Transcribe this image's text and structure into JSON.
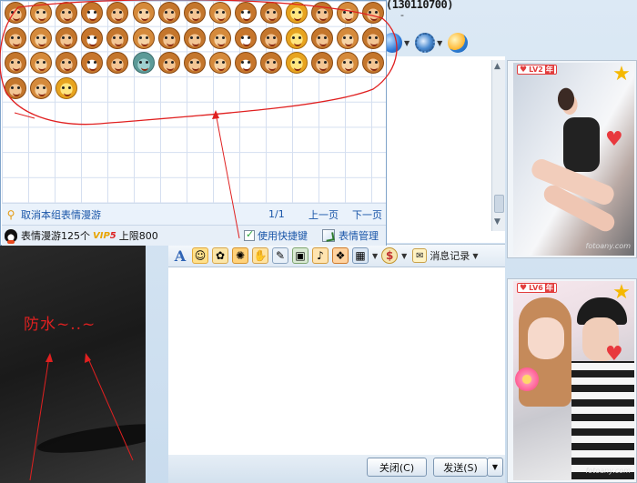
{
  "window": {
    "title_number": "(130110700)",
    "title_suffix": "-"
  },
  "emoticon_panel": {
    "cancel_roam_label": "取消本组表情漫游",
    "page_indicator": "1/1",
    "prev_page": "上一页",
    "next_page": "下一页",
    "roam_count_label": "表情漫游125个",
    "vip_label": "VIP",
    "vip_level": "5",
    "limit_label": "上限800",
    "shortcut_label": "使用快捷键",
    "manage_label": "表情管理",
    "emoticon_count_visible": 48
  },
  "input_toolbar": {
    "font_icon": "A",
    "message_record_label": "消息记录"
  },
  "buttons": {
    "close_label": "关闭(C)",
    "send_label": "发送(S)"
  },
  "show_panels": [
    {
      "level": "LV2",
      "year_badge": "年",
      "level_star": "LV2",
      "watermark": "fotoany.com"
    },
    {
      "level": "LV6",
      "year_badge": "年",
      "level_star": "LV6",
      "watermark": "fotoany.com"
    }
  ],
  "annotation": {
    "text": "防水~..~",
    "color": "#e02020"
  },
  "colors": {
    "accent_blue": "#1955a8",
    "annotation_red": "#e02020",
    "window_bg": "#c9dcee"
  }
}
